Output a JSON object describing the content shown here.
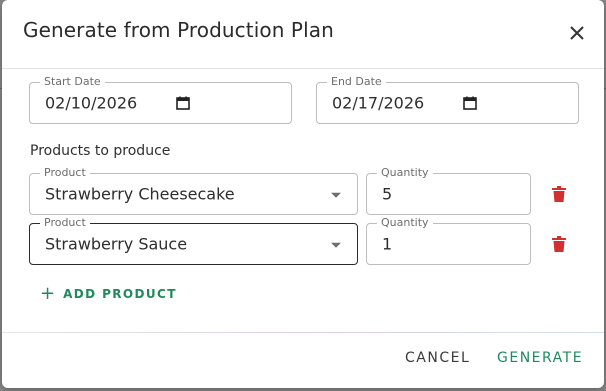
{
  "dialog": {
    "title": "Generate from Production Plan",
    "close_icon": "close-icon"
  },
  "dates": {
    "start": {
      "label": "Start Date",
      "value": "02/10/2026",
      "icon": "calendar-icon"
    },
    "end": {
      "label": "End Date",
      "value": "02/17/2026",
      "icon": "calendar-icon"
    }
  },
  "products_section": {
    "heading": "Products to produce",
    "rows": [
      {
        "product_label": "Product",
        "product_value": "Strawberry Cheesecake",
        "quantity_label": "Quantity",
        "quantity_value": "5",
        "delete_icon": "trash-icon"
      },
      {
        "product_label": "Product",
        "product_value": "Strawberry Sauce",
        "quantity_label": "Quantity",
        "quantity_value": "1",
        "delete_icon": "trash-icon"
      }
    ],
    "add_label": "ADD PRODUCT",
    "add_icon": "plus-icon"
  },
  "actions": {
    "cancel": "CANCEL",
    "generate": "GENERATE"
  },
  "colors": {
    "accent": "#1f8a5c",
    "danger": "#d32f2f"
  }
}
